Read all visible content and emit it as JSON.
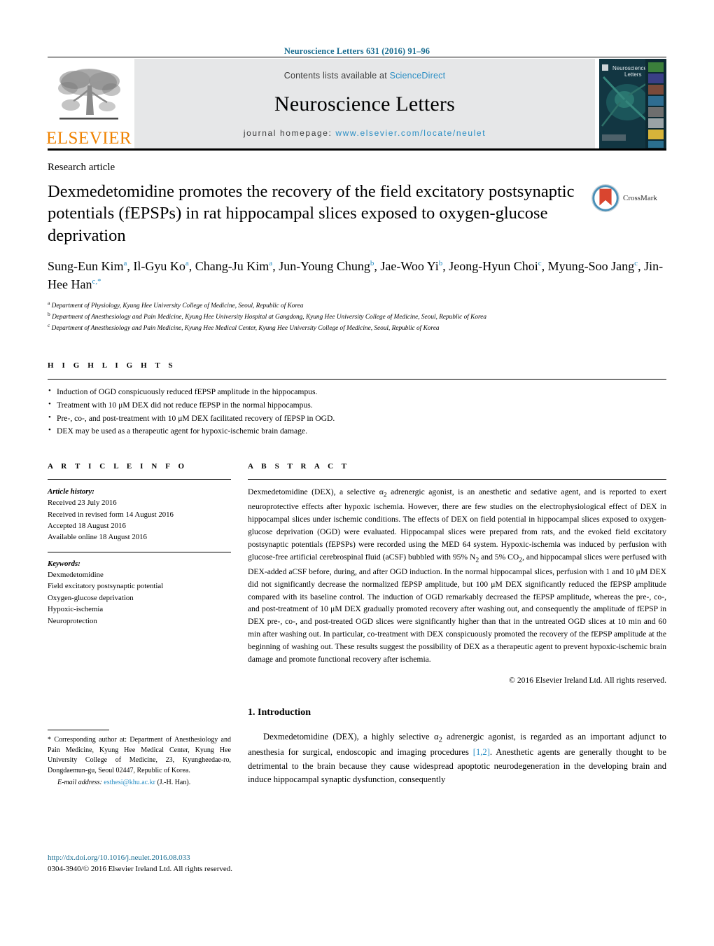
{
  "running_head": "Neuroscience Letters 631 (2016) 91–96",
  "masthead": {
    "publisher_name": "ELSEVIER",
    "contents_prefix": "Contents lists available at",
    "contents_link": "ScienceDirect",
    "journal_name": "Neuroscience Letters",
    "homepage_prefix": "journal homepage:",
    "homepage_url": "www.elsevier.com/locate/neulet",
    "cover_title_line1": "Neuroscience",
    "cover_title_line2": "Letters",
    "link_color": "#2a8ec4"
  },
  "article": {
    "type_label": "Research article",
    "title": "Dexmedetomidine promotes the recovery of the field excitatory postsynaptic potentials (fEPSPs) in rat hippocampal slices exposed to oxygen-glucose deprivation",
    "crossmark_label": "CrossMark",
    "authors": [
      {
        "name": "Sung-Eun Kim",
        "sup": "a",
        "sep": ", "
      },
      {
        "name": "Il-Gyu Ko",
        "sup": "a",
        "sep": ", "
      },
      {
        "name": "Chang-Ju Kim",
        "sup": "a",
        "sep": ", "
      },
      {
        "name": "Jun-Young Chung",
        "sup": "b",
        "sep": ", "
      },
      {
        "name": "Jae-Woo Yi",
        "sup": "b",
        "sep": ", "
      },
      {
        "name": "Jeong-Hyun Choi",
        "sup": "c",
        "sep": ", "
      },
      {
        "name": "Myung-Soo Jang",
        "sup": "c",
        "sep": ", "
      },
      {
        "name": "Jin-Hee Han",
        "sup": "c,*",
        "sep": ""
      }
    ],
    "affiliations": [
      {
        "marker": "a",
        "text": "Department of Physiology, Kyung Hee University College of Medicine, Seoul, Republic of Korea"
      },
      {
        "marker": "b",
        "text": "Department of Anesthesiology and Pain Medicine, Kyung Hee University Hospital at Gangdong, Kyung Hee University College of Medicine, Seoul, Republic of Korea"
      },
      {
        "marker": "c",
        "text": "Department of Anesthesiology and Pain Medicine, Kyung Hee Medical Center, Kyung Hee University College of Medicine, Seoul, Republic of Korea"
      }
    ]
  },
  "highlights": {
    "heading": "H I G H L I G H T S",
    "items": [
      "Induction of OGD conspicuously reduced fEPSP amplitude in the hippocampus.",
      "Treatment with 10 μM DEX did not reduce fEPSP in the normal hippocampus.",
      "Pre-, co-, and post-treatment with 10 μM DEX facilitated recovery of fEPSP in OGD.",
      "DEX may be used as a therapeutic agent for hypoxic-ischemic brain damage."
    ]
  },
  "article_info": {
    "heading": "A R T I C L E   I N F O",
    "history_title": "Article history:",
    "history": [
      "Received 23 July 2016",
      "Received in revised form 14 August 2016",
      "Accepted 18 August 2016",
      "Available online 18 August 2016"
    ],
    "keywords_title": "Keywords:",
    "keywords": [
      "Dexmedetomidine",
      "Field excitatory postsynaptic potential",
      "Oxygen-glucose deprivation",
      "Hypoxic-ischemia",
      "Neuroprotection"
    ]
  },
  "abstract": {
    "heading": "A B S T R A C T",
    "body": "Dexmedetomidine (DEX), a selective α2 adrenergic agonist, is an anesthetic and sedative agent, and is reported to exert neuroprotective effects after hypoxic ischemia. However, there are few studies on the electrophysiological effect of DEX in hippocampal slices under ischemic conditions. The effects of DEX on field potential in hippocampal slices exposed to oxygen-glucose deprivation (OGD) were evaluated. Hippocampal slices were prepared from rats, and the evoked field excitatory postsynaptic potentials (fEPSPs) were recorded using the MED 64 system. Hypoxic-ischemia was induced by perfusion with glucose-free artificial cerebrospinal fluid (aCSF) bubbled with 95% N2 and 5% CO2, and hippocampal slices were perfused with DEX-added aCSF before, during, and after OGD induction. In the normal hippocampal slices, perfusion with 1 and 10 μM DEX did not significantly decrease the normalized fEPSP amplitude, but 100 μM DEX significantly reduced the fEPSP amplitude compared with its baseline control. The induction of OGD remarkably decreased the fEPSP amplitude, whereas the pre-, co-, and post-treatment of 10 μM DEX gradually promoted recovery after washing out, and consequently the amplitude of fEPSP in DEX pre-, co-, and post-treated OGD slices were significantly higher than that in the untreated OGD slices at 10 min and 60 min after washing out. In particular, co-treatment with DEX conspicuously promoted the recovery of the fEPSP amplitude at the beginning of washing out. These results suggest the possibility of DEX as a therapeutic agent to prevent hypoxic-ischemic brain damage and promote functional recovery after ischemia.",
    "copyright": "© 2016 Elsevier Ireland Ltd. All rights reserved."
  },
  "introduction": {
    "heading": "1. Introduction",
    "paragraph_part1": "Dexmedetomidine (DEX), a highly selective α2 adrenergic agonist, is regarded as an important adjunct to anesthesia for surgical, endoscopic and imaging procedures ",
    "reference": "[1,2]",
    "paragraph_part2": ". Anesthetic agents are generally thought to be detrimental to the brain because they cause widespread apoptotic neurodegeneration in the developing brain and induce hippocampal synaptic dysfunction, consequently"
  },
  "corresponding": {
    "star": "*",
    "text": "Corresponding author at: Department of Anesthesiology and Pain Medicine, Kyung Hee Medical Center, Kyung Hee University College of Medicine, 23, Kyungheedae-ro, Dongdaemun-gu, Seoul 02447, Republic of Korea.",
    "email_label": "E-mail address:",
    "email": "esthesi@khu.ac.kr",
    "email_person": "(J.-H. Han)."
  },
  "footer": {
    "doi": "http://dx.doi.org/10.1016/j.neulet.2016.08.033",
    "issn_line": "0304-3940/© 2016 Elsevier Ireland Ltd. All rights reserved."
  }
}
